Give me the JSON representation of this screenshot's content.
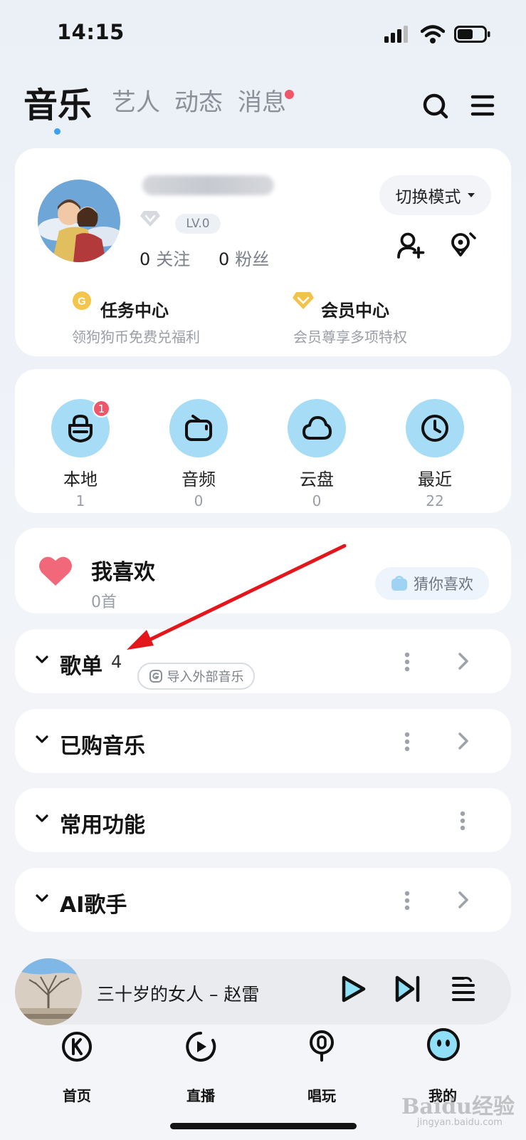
{
  "status_bar": {
    "time": "14:15"
  },
  "top_nav": {
    "tabs": [
      {
        "label": "音乐"
      },
      {
        "label": "艺人"
      },
      {
        "label": "动态"
      },
      {
        "label": "消息"
      }
    ],
    "icons": [
      "search-icon",
      "menu-icon"
    ]
  },
  "profile": {
    "switch_mode_label": "切换模式",
    "level": "LV.0",
    "following_count": "0",
    "following_label": "关注",
    "fans_count": "0",
    "fans_label": "粉丝",
    "task_center_title": "任务中心",
    "task_center_sub": "领狗狗币免费兑福利",
    "vip_center_title": "会员中心",
    "vip_center_sub": "会员尊享多项特权"
  },
  "shortcuts": [
    {
      "label": "本地",
      "count": "1",
      "badge": "1",
      "icon": "local-music-icon"
    },
    {
      "label": "音频",
      "count": "0",
      "icon": "radio-icon"
    },
    {
      "label": "云盘",
      "count": "0",
      "icon": "cloud-icon"
    },
    {
      "label": "最近",
      "count": "22",
      "icon": "clock-icon"
    }
  ],
  "favorites": {
    "title": "我喜欢",
    "count": "0首",
    "guess_label": "猜你喜欢"
  },
  "sections": {
    "playlists": {
      "title": "歌单",
      "count": "4",
      "import_label": "导入外部音乐"
    },
    "purchased": {
      "title": "已购音乐"
    },
    "common": {
      "title": "常用功能"
    },
    "ai_singer": {
      "title": "AI歌手"
    }
  },
  "player": {
    "song": "三十岁的女人 – 赵雷"
  },
  "bottom_nav": [
    {
      "label": "首页",
      "icon": "home-k-icon"
    },
    {
      "label": "直播",
      "icon": "live-icon"
    },
    {
      "label": "唱玩",
      "icon": "mic-icon"
    },
    {
      "label": "我的",
      "icon": "me-avatar-icon"
    }
  ],
  "watermark": {
    "brand": "Baidu经验",
    "url": "jingyan.baidu.com"
  },
  "colors": {
    "accent_blue": "#3c9ff0",
    "badge_red": "#f0566a",
    "shortcut_circle": "#a6dcf6",
    "heart_pink": "#f0687a",
    "annotation_arrow": "#e3161c"
  }
}
